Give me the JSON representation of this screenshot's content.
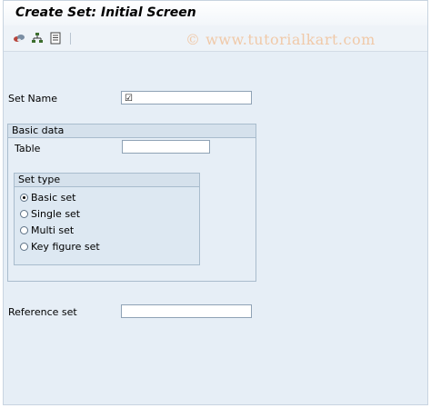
{
  "header": {
    "title": "Create Set: Initial Screen"
  },
  "toolbar": {
    "buttons": [
      {
        "icon": "display-set-icon"
      },
      {
        "icon": "hierarchy-icon"
      },
      {
        "icon": "document-icon"
      }
    ]
  },
  "watermark": "© www.tutorialkart.com",
  "form": {
    "set_name": {
      "label": "Set Name",
      "value": "☑"
    },
    "basic_data": {
      "title": "Basic data",
      "table": {
        "label": "Table",
        "value": ""
      },
      "set_type": {
        "title": "Set type",
        "options": [
          {
            "label": "Basic set",
            "selected": true
          },
          {
            "label": "Single set",
            "selected": false
          },
          {
            "label": "Multi set",
            "selected": false
          },
          {
            "label": "Key figure set",
            "selected": false
          }
        ]
      }
    },
    "reference_set": {
      "label": "Reference set",
      "value": ""
    }
  }
}
